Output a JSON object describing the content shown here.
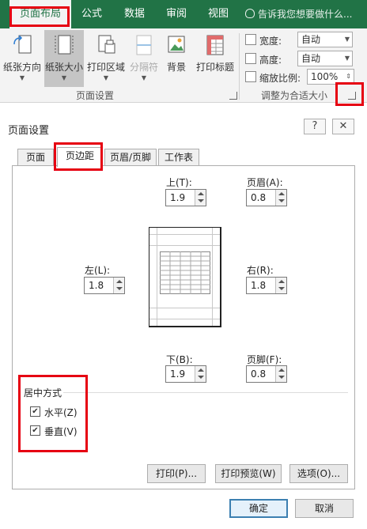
{
  "ribbon": {
    "tabs": [
      {
        "label": "页面布局",
        "active": true
      },
      {
        "label": "公式"
      },
      {
        "label": "数据"
      },
      {
        "label": "审阅"
      },
      {
        "label": "视图"
      }
    ],
    "tell_me": "告诉我您想要做什么...",
    "page_setup": {
      "buttons": [
        {
          "label": "纸张方向",
          "icon": "orientation-icon"
        },
        {
          "label": "纸张大小",
          "icon": "paper-size-icon",
          "selected": true
        },
        {
          "label": "打印区域",
          "icon": "print-area-icon"
        },
        {
          "label": "分隔符",
          "icon": "breaks-icon",
          "disabled": true
        },
        {
          "label": "背景",
          "icon": "background-icon"
        },
        {
          "label": "打印标题",
          "icon": "print-titles-icon"
        }
      ],
      "group_label": "页面设置"
    },
    "scale_to_fit": {
      "width_label": "宽度:",
      "width_value": "自动",
      "height_label": "高度:",
      "height_value": "自动",
      "scale_label": "缩放比例:",
      "scale_value": "100%",
      "group_label": "调整为合适大小"
    }
  },
  "dialog": {
    "title": "页面设置",
    "help_label": "?",
    "close_label": "✕",
    "tabs": [
      {
        "label": "页面"
      },
      {
        "label": "页边距",
        "active": true
      },
      {
        "label": "页眉/页脚"
      },
      {
        "label": "工作表"
      }
    ],
    "margins": {
      "top_label": "上(T):",
      "top_value": "1.9",
      "header_label": "页眉(A):",
      "header_value": "0.8",
      "left_label": "左(L):",
      "left_value": "1.8",
      "right_label": "右(R):",
      "right_value": "1.8",
      "bottom_label": "下(B):",
      "bottom_value": "1.9",
      "footer_label": "页脚(F):",
      "footer_value": "0.8"
    },
    "center": {
      "group_label": "居中方式",
      "horizontal_label": "水平(Z)",
      "horizontal_checked": true,
      "vertical_label": "垂直(V)",
      "vertical_checked": true
    },
    "buttons": {
      "print": "打印(P)...",
      "print_preview": "打印预览(W)",
      "options": "选项(O)...",
      "ok": "确定",
      "cancel": "取消"
    }
  },
  "colors": {
    "ribbon_green": "#217346",
    "highlight_red": "#e60012"
  }
}
